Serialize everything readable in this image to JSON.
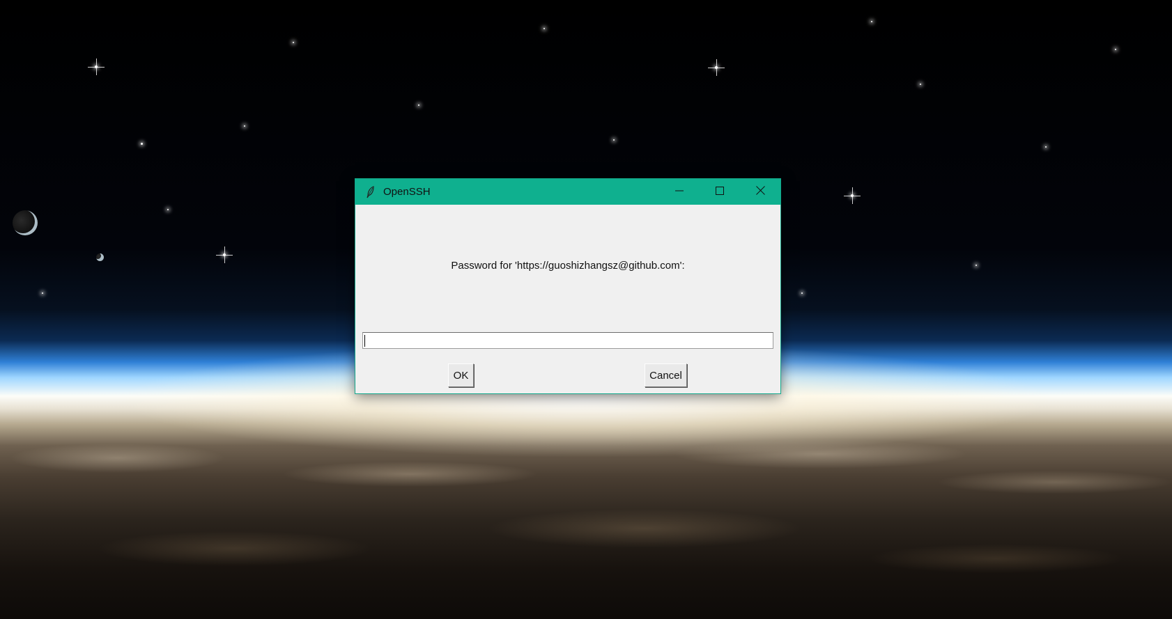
{
  "dialog": {
    "title": "OpenSSH",
    "app_icon": "feather-icon",
    "title_buttons": {
      "minimize_icon": "minimize-icon",
      "maximize_icon": "maximize-icon",
      "close_icon": "close-icon"
    },
    "prompt": "Password for 'https://guoshizhangsz@github.com':",
    "password_value": "",
    "ok_label": "OK",
    "cancel_label": "Cancel"
  },
  "colors": {
    "titlebar": "#0fb08f",
    "dialog_bg": "#f0f0f0"
  },
  "desktop": {
    "wallpaper": "earth-horizon-from-space"
  }
}
